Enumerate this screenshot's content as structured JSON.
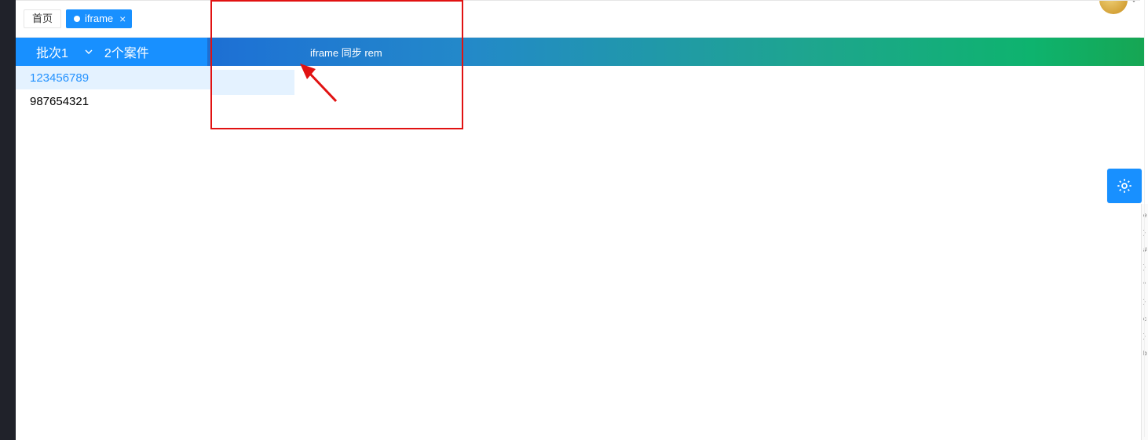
{
  "tabs": {
    "home": "首页",
    "active": "iframe"
  },
  "header": {
    "batch_label": "批次1",
    "case_count": "2个案件",
    "title": "iframe 同步 rem"
  },
  "sidebar": {
    "items": [
      {
        "id": "123456789",
        "selected": true
      },
      {
        "id": "987654321",
        "selected": false
      }
    ]
  },
  "right_snippets": [
    "e",
    "}",
    "#",
    "}",
    "*",
    "}",
    "c",
    "}",
    "b"
  ]
}
